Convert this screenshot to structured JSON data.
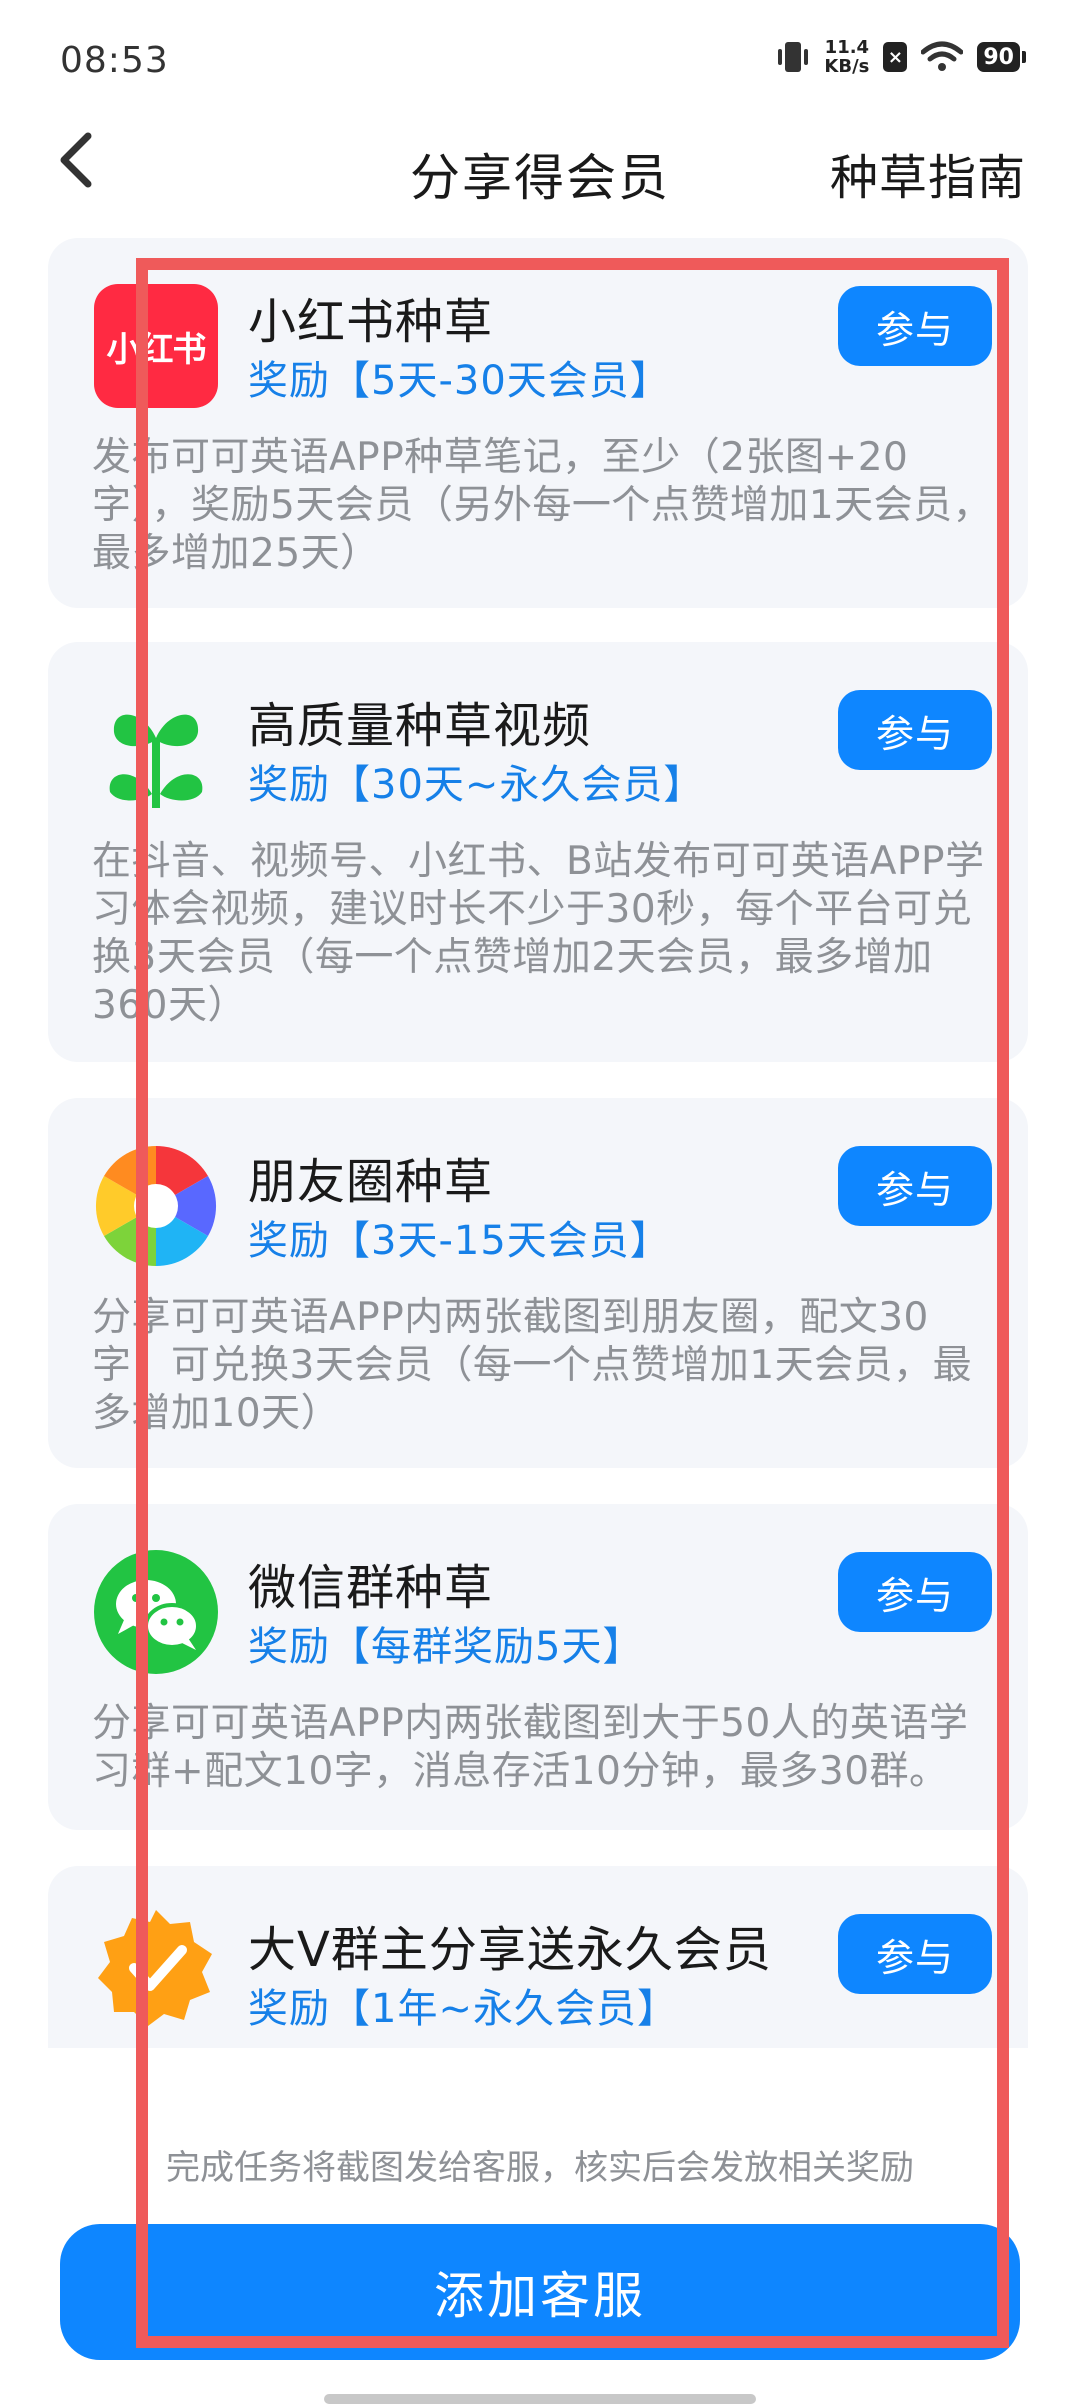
{
  "status_bar": {
    "time": "08:53",
    "net_speed_value": "11.4",
    "net_speed_unit": "KB/s",
    "sim_status": "×",
    "battery": "90"
  },
  "header": {
    "title": "分享得会员",
    "guide_link": "种草指南"
  },
  "tasks": [
    {
      "icon": "xiaohongshu-logo-icon",
      "icon_text": "小红书",
      "name": "小红书种草",
      "reward": "奖励【5天-30天会员】",
      "button": "参与",
      "description": "发布可可英语APP种草笔记，至少（2张图+20字），奖励5天会员（另外每一个点赞增加1天会员，最多增加25天）"
    },
    {
      "icon": "sprout-icon",
      "name": "高质量种草视频",
      "reward": "奖励【30天~永久会员】",
      "button": "参与",
      "description": "在抖音、视频号、小红书、B站发布可可英语APP学习体会视频，建议时长不少于30秒，每个平台可兑换3天会员（每一个点赞增加2天会员，最多增加360天）"
    },
    {
      "icon": "moments-aperture-icon",
      "name": "朋友圈种草",
      "reward": "奖励【3天-15天会员】",
      "button": "参与",
      "description": "分享可可英语APP内两张截图到朋友圈，配文30字，可兑换3天会员（每一个点赞增加1天会员，最多增加10天）"
    },
    {
      "icon": "wechat-chat-icon",
      "name": "微信群种草",
      "reward": "奖励【每群奖励5天】",
      "button": "参与",
      "description": "分享可可英语APP内两张截图到大于50人的英语学习群+配文10字，消息存活10分钟，最多30群。"
    },
    {
      "icon": "verified-badge-icon",
      "name": "大V群主分享送永久会员",
      "reward": "奖励【1年~永久会员】",
      "button": "参与",
      "description": ""
    }
  ],
  "footer": {
    "note": "完成任务将截图发给客服，核实后会发放相关奖励",
    "button": "添加客服"
  },
  "colors": {
    "accent": "#0e86ff",
    "reward_text": "#1680e8",
    "card_bg": "#f4f6fa",
    "desc_text": "#8e9196",
    "highlight": "#ef5a5a"
  }
}
